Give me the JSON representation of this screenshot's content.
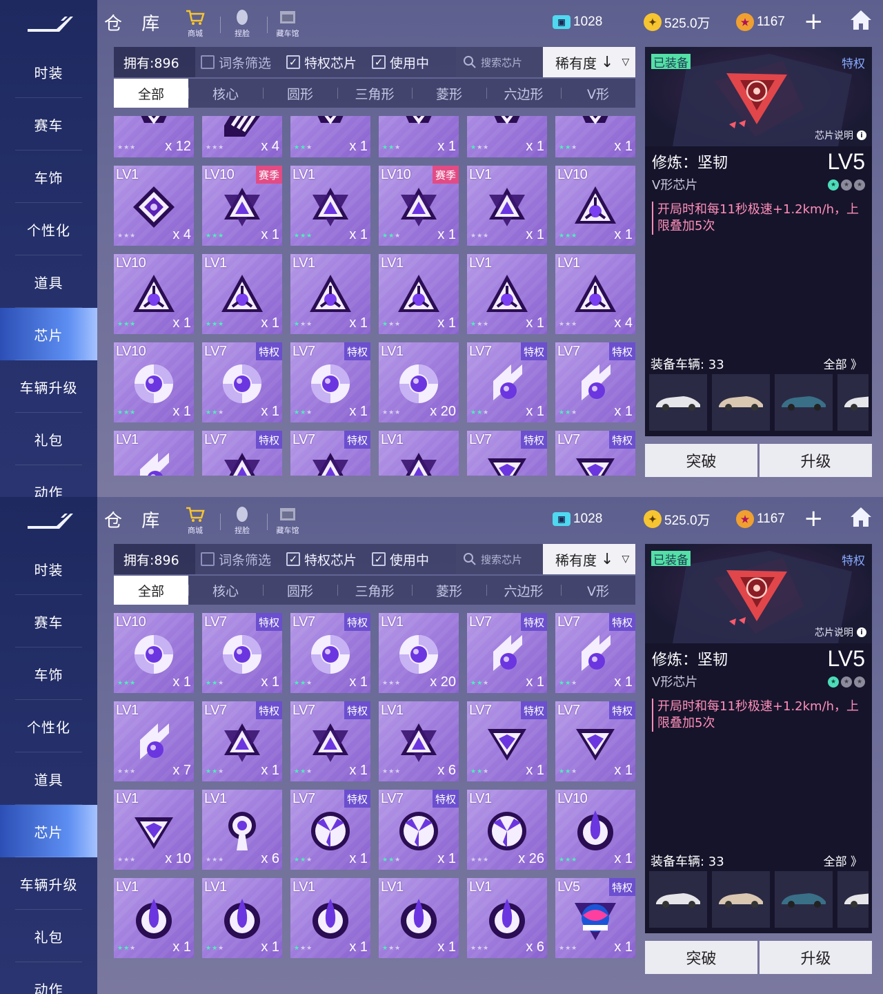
{
  "sidebar": {
    "items": [
      {
        "label": "时装"
      },
      {
        "label": "赛车"
      },
      {
        "label": "车饰"
      },
      {
        "label": "个性化"
      },
      {
        "label": "道具"
      },
      {
        "label": "芯片",
        "active": true
      },
      {
        "label": "车辆升级"
      },
      {
        "label": "礼包"
      },
      {
        "label": "动作"
      }
    ]
  },
  "header": {
    "title": "仓 库",
    "nav": [
      {
        "label": "商城",
        "icon": "shop-cart-icon"
      },
      {
        "label": "捏脸",
        "icon": "face-icon"
      },
      {
        "label": "藏车馆",
        "icon": "garage-icon"
      }
    ],
    "currencies": [
      {
        "value": "1028",
        "icon": "ticket-icon",
        "color": "#4fd8f0"
      },
      {
        "value": "525.0万",
        "icon": "coin-icon",
        "color": "#f7c531"
      },
      {
        "value": "1167",
        "icon": "star-coin-icon",
        "color": "#f0a030"
      }
    ],
    "plus": "+"
  },
  "filter": {
    "owned": "拥有:896",
    "entry_filter": "词条筛选",
    "privilege_chips": "特权芯片",
    "in_use": "使用中",
    "search_placeholder": "搜索芯片",
    "sort": "稀有度"
  },
  "tabs": [
    "全部",
    "核心",
    "圆形",
    "三角形",
    "菱形",
    "六边形",
    "V形"
  ],
  "detail": {
    "equipped": "已装备",
    "privilege": "特权",
    "description_link": "芯片说明",
    "name": "修炼：坚韧",
    "level": "LV5",
    "type": "V形芯片",
    "effect": "开局时和每11秒极速+1.2km/h，上限叠加5次",
    "vehicles_label": "装备车辆: 33",
    "vehicles_all": "全部 》",
    "breakthrough": "突破",
    "upgrade": "升级"
  },
  "colors": {
    "sidebar_active": "#5d8ef1",
    "star_on": "#4ef0b9",
    "season_tag": "#e34b84",
    "privilege_tag": "#6b4fcf",
    "effect_text": "#ff8fb8",
    "equipped_badge": "#54e0a6"
  },
  "panel1_cards": [
    {
      "lv": "",
      "tag": "",
      "shape": "crown",
      "stars": 0,
      "qty": "x 12"
    },
    {
      "lv": "",
      "tag": "",
      "shape": "stripe",
      "stars": 0,
      "qty": "x 4"
    },
    {
      "lv": "",
      "tag": "",
      "shape": "crown",
      "stars": 2,
      "qty": "x 1"
    },
    {
      "lv": "",
      "tag": "",
      "shape": "crown",
      "stars": 2,
      "qty": "x 1"
    },
    {
      "lv": "",
      "tag": "",
      "shape": "crown",
      "stars": 1,
      "qty": "x 1"
    },
    {
      "lv": "",
      "tag": "",
      "shape": "crown",
      "stars": 2,
      "qty": "x 1"
    },
    {
      "lv": "LV1",
      "tag": "",
      "shape": "diamond",
      "stars": 0,
      "qty": "x 4"
    },
    {
      "lv": "LV10",
      "tag": "赛季",
      "shape": "hexstar",
      "stars": 3,
      "qty": "x 1"
    },
    {
      "lv": "LV1",
      "tag": "",
      "shape": "hexstar",
      "stars": 3,
      "qty": "x 1"
    },
    {
      "lv": "LV10",
      "tag": "赛季",
      "shape": "hexstar",
      "stars": 2,
      "qty": "x 1"
    },
    {
      "lv": "LV1",
      "tag": "",
      "shape": "hexstar",
      "stars": 0,
      "qty": "x 1"
    },
    {
      "lv": "LV10",
      "tag": "",
      "shape": "tri",
      "stars": 3,
      "qty": "x 1"
    },
    {
      "lv": "LV10",
      "tag": "",
      "shape": "tri",
      "stars": 3,
      "qty": "x 1"
    },
    {
      "lv": "LV1",
      "tag": "",
      "shape": "tri",
      "stars": 3,
      "qty": "x 1"
    },
    {
      "lv": "LV1",
      "tag": "",
      "shape": "tri",
      "stars": 1,
      "qty": "x 1"
    },
    {
      "lv": "LV1",
      "tag": "",
      "shape": "tri",
      "stars": 1,
      "qty": "x 1"
    },
    {
      "lv": "LV1",
      "tag": "",
      "shape": "tri",
      "stars": 1,
      "qty": "x 1"
    },
    {
      "lv": "LV1",
      "tag": "",
      "shape": "tri",
      "stars": 0,
      "qty": "x 4"
    },
    {
      "lv": "LV10",
      "tag": "",
      "shape": "swirl",
      "stars": 3,
      "qty": "x 1"
    },
    {
      "lv": "LV7",
      "tag": "特权",
      "shape": "swirl",
      "stars": 2,
      "qty": "x 1"
    },
    {
      "lv": "LV7",
      "tag": "特权",
      "shape": "swirl",
      "stars": 2,
      "qty": "x 1"
    },
    {
      "lv": "LV1",
      "tag": "",
      "shape": "swirl",
      "stars": 0,
      "qty": "x 20"
    },
    {
      "lv": "LV7",
      "tag": "特权",
      "shape": "comet",
      "stars": 2,
      "qty": "x 1"
    },
    {
      "lv": "LV7",
      "tag": "特权",
      "shape": "comet",
      "stars": 2,
      "qty": "x 1"
    },
    {
      "lv": "LV1",
      "tag": "",
      "shape": "comet",
      "stars": 0,
      "qty": ""
    },
    {
      "lv": "LV7",
      "tag": "特权",
      "shape": "hexstar",
      "stars": 0,
      "qty": ""
    },
    {
      "lv": "LV7",
      "tag": "特权",
      "shape": "hexstar",
      "stars": 0,
      "qty": ""
    },
    {
      "lv": "LV1",
      "tag": "",
      "shape": "hexstar",
      "stars": 0,
      "qty": ""
    },
    {
      "lv": "LV7",
      "tag": "特权",
      "shape": "vshape",
      "stars": 0,
      "qty": ""
    },
    {
      "lv": "LV7",
      "tag": "特权",
      "shape": "vshape",
      "stars": 0,
      "qty": ""
    }
  ],
  "panel2_cards": [
    {
      "lv": "LV10",
      "tag": "",
      "shape": "swirl",
      "stars": 3,
      "qty": "x 1"
    },
    {
      "lv": "LV7",
      "tag": "特权",
      "shape": "swirl",
      "stars": 2,
      "qty": "x 1"
    },
    {
      "lv": "LV7",
      "tag": "特权",
      "shape": "swirl",
      "stars": 2,
      "qty": "x 1"
    },
    {
      "lv": "LV1",
      "tag": "",
      "shape": "swirl",
      "stars": 0,
      "qty": "x 20"
    },
    {
      "lv": "LV7",
      "tag": "特权",
      "shape": "comet",
      "stars": 2,
      "qty": "x 1"
    },
    {
      "lv": "LV7",
      "tag": "特权",
      "shape": "comet",
      "stars": 2,
      "qty": "x 1"
    },
    {
      "lv": "LV1",
      "tag": "",
      "shape": "comet",
      "stars": 0,
      "qty": "x 7"
    },
    {
      "lv": "LV7",
      "tag": "特权",
      "shape": "hexstar",
      "stars": 2,
      "qty": "x 1"
    },
    {
      "lv": "LV7",
      "tag": "特权",
      "shape": "hexstar",
      "stars": 2,
      "qty": "x 1"
    },
    {
      "lv": "LV1",
      "tag": "",
      "shape": "hexstar",
      "stars": 0,
      "qty": "x 6"
    },
    {
      "lv": "LV7",
      "tag": "特权",
      "shape": "vshape",
      "stars": 2,
      "qty": "x 1"
    },
    {
      "lv": "LV7",
      "tag": "特权",
      "shape": "vshape",
      "stars": 2,
      "qty": "x 1"
    },
    {
      "lv": "LV1",
      "tag": "",
      "shape": "vshape",
      "stars": 0,
      "qty": "x 10"
    },
    {
      "lv": "LV1",
      "tag": "",
      "shape": "keyhole",
      "stars": 0,
      "qty": "x 6"
    },
    {
      "lv": "LV7",
      "tag": "特权",
      "shape": "trinity",
      "stars": 2,
      "qty": "x 1"
    },
    {
      "lv": "LV7",
      "tag": "特权",
      "shape": "trinity",
      "stars": 2,
      "qty": "x 1"
    },
    {
      "lv": "LV1",
      "tag": "",
      "shape": "trinity",
      "stars": 0,
      "qty": "x 26"
    },
    {
      "lv": "LV10",
      "tag": "",
      "shape": "flame",
      "stars": 3,
      "qty": "x 1"
    },
    {
      "lv": "LV1",
      "tag": "",
      "shape": "flame",
      "stars": 2,
      "qty": "x 1"
    },
    {
      "lv": "LV1",
      "tag": "",
      "shape": "flame",
      "stars": 2,
      "qty": "x 1"
    },
    {
      "lv": "LV1",
      "tag": "",
      "shape": "flame",
      "stars": 1,
      "qty": "x 1"
    },
    {
      "lv": "LV1",
      "tag": "",
      "shape": "flame",
      "stars": 1,
      "qty": "x 1"
    },
    {
      "lv": "LV1",
      "tag": "",
      "shape": "flame",
      "stars": 0,
      "qty": "x 6"
    },
    {
      "lv": "LV5",
      "tag": "特权",
      "shape": "unreal",
      "stars": 0,
      "qty": "x 1"
    }
  ]
}
